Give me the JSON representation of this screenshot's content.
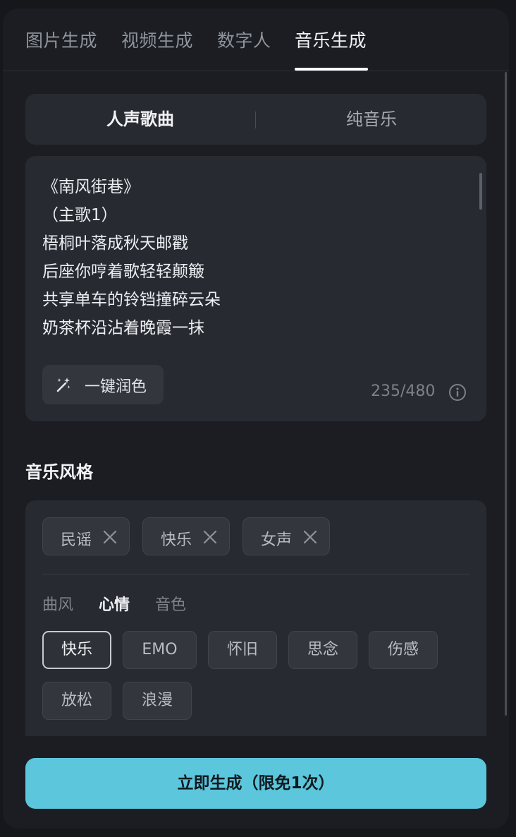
{
  "tabs": [
    {
      "label": "图片生成"
    },
    {
      "label": "视频生成"
    },
    {
      "label": "数字人"
    },
    {
      "label": "音乐生成"
    }
  ],
  "active_tab": "音乐生成",
  "mode": {
    "options": [
      "人声歌曲",
      "纯音乐"
    ],
    "selected": "人声歌曲"
  },
  "lyrics": {
    "text": "《南风街巷》\n（主歌1）\n梧桐叶落成秋天邮戳\n后座你哼着歌轻轻颠簸\n共享单车的铃铛撞碎云朵\n奶茶杯沿沾着晚霞一抹",
    "polish_label": "一键润色",
    "counter": "235/480"
  },
  "style": {
    "title": "音乐风格",
    "selected_tags": [
      "民谣",
      "快乐",
      "女声"
    ],
    "categories": [
      "曲风",
      "心情",
      "音色"
    ],
    "active_category": "心情",
    "options": [
      "快乐",
      "EMO",
      "怀旧",
      "思念",
      "伤感",
      "放松",
      "浪漫"
    ],
    "active_option": "快乐"
  },
  "generate_label": "立即生成（限免1次）",
  "colors": {
    "accent": "#5bc6dc",
    "background": "#1b1d22"
  }
}
